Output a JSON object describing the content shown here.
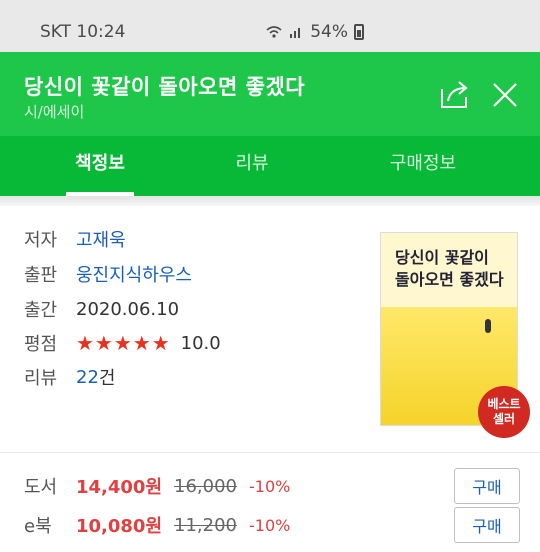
{
  "status_bar": {
    "carrier": "SKT",
    "time": "10:24",
    "battery": "54%"
  },
  "header": {
    "title": "당신이 꽃같이 돌아오면 좋겠다",
    "category": "시/에세이"
  },
  "tabs": [
    {
      "label": "책정보"
    },
    {
      "label": "리뷰"
    },
    {
      "label": "구매정보"
    }
  ],
  "book_info": {
    "author_label": "저자",
    "author": "고재욱",
    "publisher_label": "출판",
    "publisher": "웅진지식하우스",
    "date_label": "출간",
    "date": "2020.06.10",
    "rating_label": "평점",
    "stars": "★★★★★",
    "rating": "10.0",
    "review_label": "리뷰",
    "review_count": "22",
    "review_unit": "건"
  },
  "cover": {
    "title_line1": "당신이 꽃같이",
    "title_line2": "돌아오면 좋겠다",
    "badge_line1": "베스트",
    "badge_line2": "셀러"
  },
  "prices": [
    {
      "label": "도서",
      "sale": "14,400원",
      "original": "16,000",
      "discount": "-10%",
      "button": "구매"
    },
    {
      "label": "e북",
      "sale": "10,080원",
      "original": "11,200",
      "discount": "-10%",
      "button": "구매"
    }
  ],
  "colors": {
    "header_green": "#1ec74a",
    "tab_green": "#07b936",
    "link_blue": "#1a5fb4",
    "price_red": "#e04040"
  }
}
